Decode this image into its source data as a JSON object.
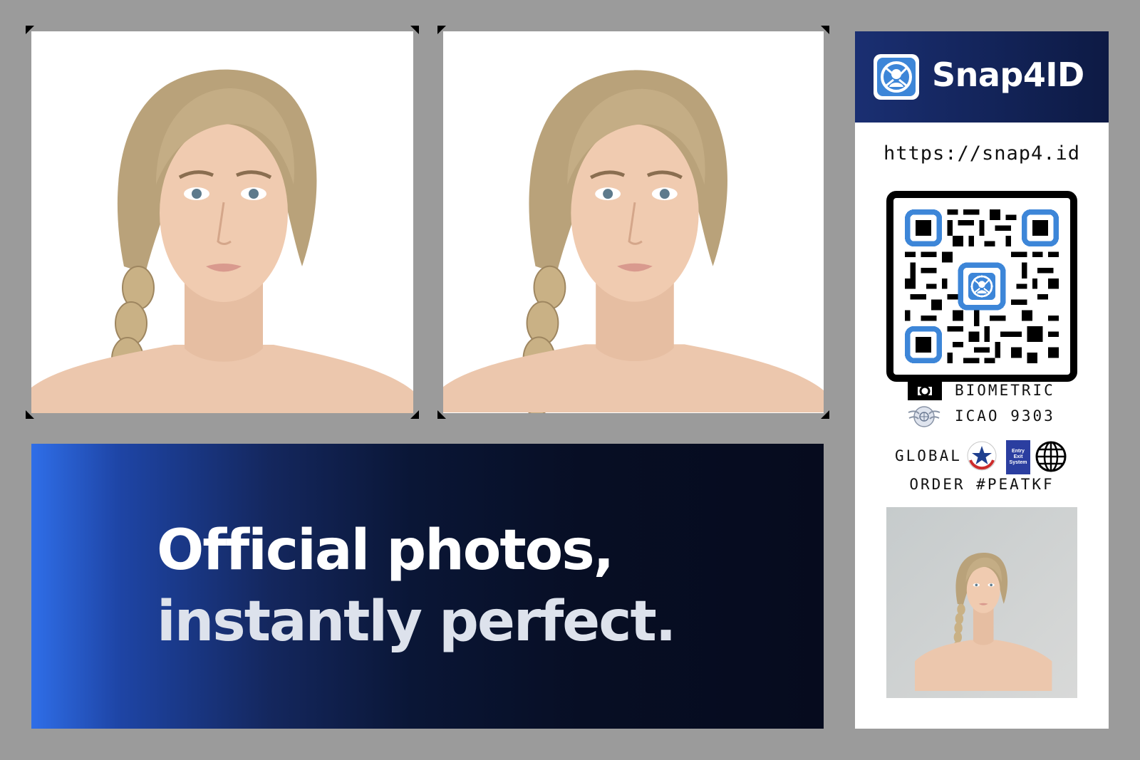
{
  "banner": {
    "headline_line1": "Official photos,",
    "headline_line2": "instantly perfect."
  },
  "brand": {
    "name": "Snap4ID",
    "logo_icon": "snap4id-logo-icon"
  },
  "panel": {
    "url": "https://snap4.id",
    "badges": {
      "biometric": "BIOMETRIC",
      "icao": "ICAO 9303",
      "global": "GLOBAL",
      "entry_exit_line1": "Entry",
      "entry_exit_line2": "Exit",
      "entry_exit_line3": "System"
    },
    "order": "ORDER #PEATKF"
  },
  "colors": {
    "background": "#9b9b9b",
    "brand_navy": "#0d1a44",
    "accent_blue": "#3d86d8",
    "banner_blue": "#2f6ee8"
  }
}
